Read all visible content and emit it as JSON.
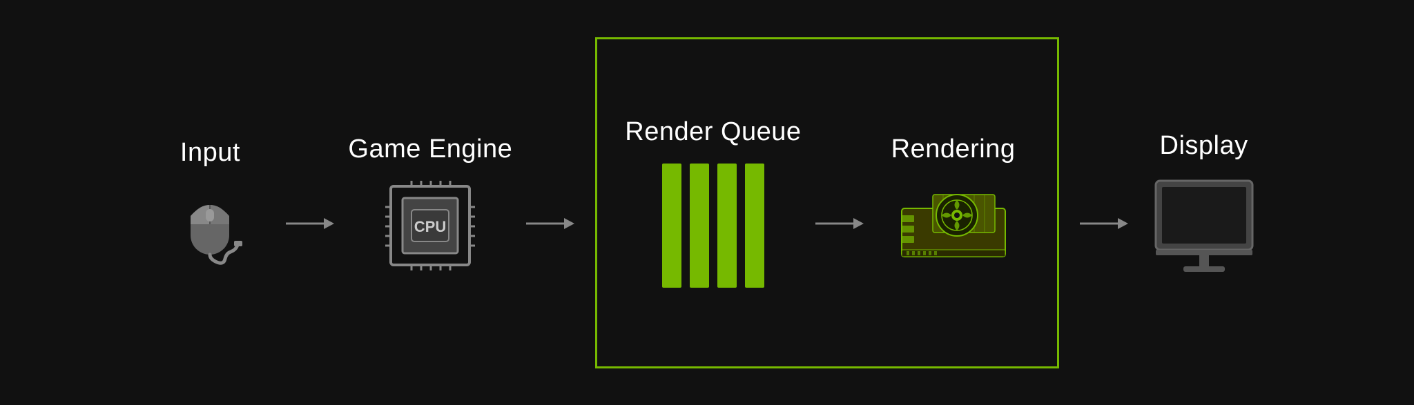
{
  "stages": {
    "input": {
      "label": "Input"
    },
    "game_engine": {
      "label": "Game Engine"
    },
    "render_queue": {
      "label": "Render Queue"
    },
    "rendering": {
      "label": "Rendering"
    },
    "display": {
      "label": "Display"
    }
  },
  "colors": {
    "background": "#111111",
    "text": "#ffffff",
    "green": "#76b900",
    "gray": "#808080",
    "dark_gray": "#555555",
    "light_gray": "#999999"
  }
}
